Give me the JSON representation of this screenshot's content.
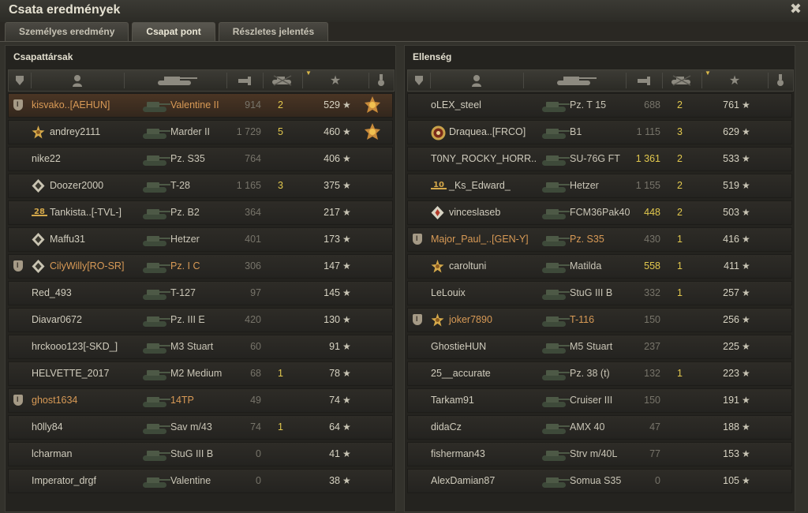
{
  "window": {
    "title": "Csata eredmények"
  },
  "tabs": [
    {
      "label": "Személyes eredmény",
      "active": false
    },
    {
      "label": "Csapat pont",
      "active": true
    },
    {
      "label": "Részletes jelentés",
      "active": false
    }
  ],
  "colors": {
    "platoon_name": "#d89a56",
    "highlight_number": "#e2c84e",
    "dim_number": "#77746a"
  },
  "icons": {
    "header": [
      "vehicle-rank-icon",
      "player-icon",
      "tank-icon",
      "damage-icon",
      "kills-icon",
      "experience-star-icon",
      "medal-icon"
    ]
  },
  "allies": {
    "title": "Csapattársak",
    "rows": [
      {
        "name": "kisvako..[AEHUN]",
        "platoon": true,
        "self": true,
        "badge": "",
        "tank": "Valentine II",
        "damage": "914",
        "kills": "2",
        "xp": "529",
        "medal": true
      },
      {
        "name": "andrey2111",
        "platoon": false,
        "badge": "gold-star",
        "tank": "Marder II",
        "damage": "1 729",
        "kills": "5",
        "xp": "460",
        "medal": true
      },
      {
        "name": "nike22",
        "platoon": false,
        "badge": "",
        "tank": "Pz. S35",
        "damage": "764",
        "kills": "",
        "xp": "406",
        "medal": false
      },
      {
        "name": "Doozer2000",
        "platoon": false,
        "badge": "diamond",
        "tank": "T-28",
        "damage": "1 165",
        "kills": "3",
        "xp": "375",
        "medal": false
      },
      {
        "name": "Tankista..[-TVL-]",
        "platoon": false,
        "badge": "28",
        "tank": "Pz. B2",
        "damage": "364",
        "kills": "",
        "xp": "217",
        "medal": false
      },
      {
        "name": "Maffu31",
        "platoon": false,
        "badge": "diamond",
        "tank": "Hetzer",
        "damage": "401",
        "kills": "",
        "xp": "173",
        "medal": false
      },
      {
        "name": "CilyWilly[RO-SR]",
        "platoon": true,
        "badge": "diamond",
        "tank": "Pz. I C",
        "damage": "306",
        "kills": "",
        "xp": "147",
        "medal": false
      },
      {
        "name": "Red_493",
        "platoon": false,
        "badge": "",
        "tank": "T-127",
        "damage": "97",
        "kills": "",
        "xp": "145",
        "medal": false
      },
      {
        "name": "Diavar0672",
        "platoon": false,
        "badge": "",
        "tank": "Pz. III E",
        "damage": "420",
        "kills": "",
        "xp": "130",
        "medal": false
      },
      {
        "name": "hrckooo123[-SKD_]",
        "platoon": false,
        "badge": "",
        "tank": "M3 Stuart",
        "damage": "60",
        "kills": "",
        "xp": "91",
        "medal": false
      },
      {
        "name": "HELVETTE_2017",
        "platoon": false,
        "badge": "",
        "tank": "M2 Medium",
        "damage": "68",
        "kills": "1",
        "xp": "78",
        "medal": false
      },
      {
        "name": "ghost1634",
        "platoon": true,
        "badge": "",
        "tank": "14TP",
        "damage": "49",
        "kills": "",
        "xp": "74",
        "medal": false
      },
      {
        "name": "h0lly84",
        "platoon": false,
        "badge": "",
        "tank": "Sav m/43",
        "damage": "74",
        "kills": "1",
        "xp": "64",
        "medal": false
      },
      {
        "name": "lcharman",
        "platoon": false,
        "badge": "",
        "tank": "StuG III B",
        "damage": "0",
        "kills": "",
        "xp": "41",
        "medal": false
      },
      {
        "name": "Imperator_drgf",
        "platoon": false,
        "badge": "",
        "tank": "Valentine",
        "damage": "0",
        "kills": "",
        "xp": "38",
        "medal": false
      }
    ]
  },
  "enemies": {
    "title": "Ellenség",
    "rows": [
      {
        "name": "oLEX_steel",
        "platoon": false,
        "badge": "",
        "tank": "Pz. T 15",
        "damage": "688",
        "kills": "2",
        "xp": "761",
        "medal": false
      },
      {
        "name": "Draquea..[FRCO]",
        "platoon": false,
        "badge": "gold-circle",
        "tank": "B1",
        "damage": "1 115",
        "kills": "3",
        "xp": "629",
        "medal": false
      },
      {
        "name": "T0NY_ROCKY_HORR..",
        "platoon": false,
        "badge": "",
        "tank": "SU-76G FT",
        "damage": "1 361",
        "kills": "2",
        "xp": "533",
        "medal": false,
        "dmgHi": true
      },
      {
        "name": "_Ks_Edward_",
        "platoon": false,
        "badge": "10",
        "tank": "Hetzer",
        "damage": "1 155",
        "kills": "2",
        "xp": "519",
        "medal": false
      },
      {
        "name": "vinceslaseb",
        "platoon": false,
        "badge": "red-diamond",
        "tank": "FCM36Pak40",
        "damage": "448",
        "kills": "2",
        "xp": "503",
        "medal": false,
        "dmgHi": true
      },
      {
        "name": "Major_Paul_..[GEN-Y]",
        "platoon": true,
        "badge": "",
        "tank": "Pz. S35",
        "damage": "430",
        "kills": "1",
        "xp": "416",
        "medal": false
      },
      {
        "name": "caroltuni",
        "platoon": false,
        "badge": "gold-star",
        "tank": "Matilda",
        "damage": "558",
        "kills": "1",
        "xp": "411",
        "medal": false,
        "dmgHi": true
      },
      {
        "name": "LeLouix",
        "platoon": false,
        "badge": "",
        "tank": "StuG III B",
        "damage": "332",
        "kills": "1",
        "xp": "257",
        "medal": false
      },
      {
        "name": "joker7890",
        "platoon": true,
        "badge": "gold-star",
        "tank": "T-116",
        "damage": "150",
        "kills": "",
        "xp": "256",
        "medal": false
      },
      {
        "name": "GhostieHUN",
        "platoon": false,
        "badge": "",
        "tank": "M5 Stuart",
        "damage": "237",
        "kills": "",
        "xp": "225",
        "medal": false
      },
      {
        "name": "25__accurate",
        "platoon": false,
        "badge": "",
        "tank": "Pz. 38 (t)",
        "damage": "132",
        "kills": "1",
        "xp": "223",
        "medal": false
      },
      {
        "name": "Tarkam91",
        "platoon": false,
        "badge": "",
        "tank": "Cruiser III",
        "damage": "150",
        "kills": "",
        "xp": "191",
        "medal": false
      },
      {
        "name": "didaCz",
        "platoon": false,
        "badge": "",
        "tank": "AMX 40",
        "damage": "47",
        "kills": "",
        "xp": "188",
        "medal": false
      },
      {
        "name": "fisherman43",
        "platoon": false,
        "badge": "",
        "tank": "Strv m/40L",
        "damage": "77",
        "kills": "",
        "xp": "153",
        "medal": false
      },
      {
        "name": "AlexDamian87",
        "platoon": false,
        "badge": "",
        "tank": "Somua S35",
        "damage": "0",
        "kills": "",
        "xp": "105",
        "medal": false
      }
    ]
  }
}
